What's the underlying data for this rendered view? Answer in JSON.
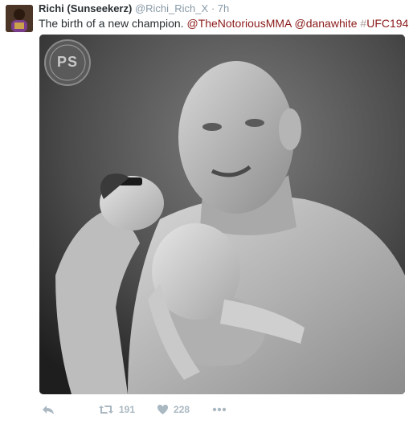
{
  "user": {
    "fullname": "Richi (Sunseekerz)",
    "username": "@Richi_Rich_X",
    "separator": "·",
    "timestamp": "7h"
  },
  "tweet": {
    "text_plain": "The birth of a new champion. ",
    "mention1": "@TheNotoriousMMA",
    "space1": " ",
    "mention2": "@danawhite",
    "space2": " ",
    "hashtag_symbol": "#",
    "hashtag_text": "UFC194"
  },
  "media": {
    "watermark_text": "PS"
  },
  "actions": {
    "retweet_count": "191",
    "like_count": "228"
  },
  "icons": {
    "reply": "reply-icon",
    "retweet": "retweet-icon",
    "like": "heart-icon",
    "more": "more-icon"
  },
  "colors": {
    "name": "#292f33",
    "meta": "#8899a6",
    "link": "#8b1a1a",
    "action": "#aab8c2"
  }
}
